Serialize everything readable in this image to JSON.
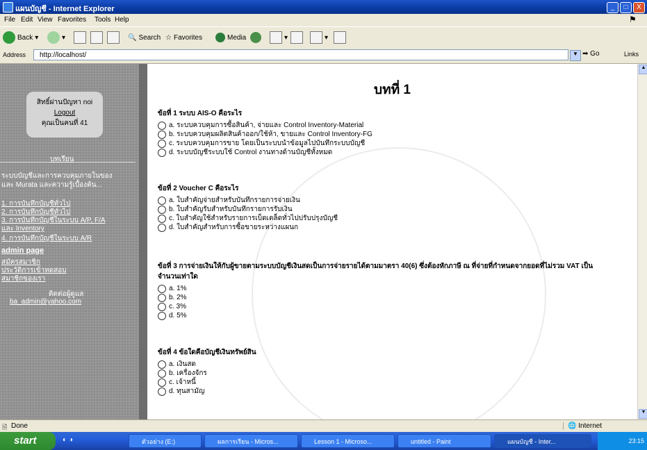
{
  "window": {
    "title": "แผนบัญชี - Internet Explorer",
    "controls": [
      "_",
      "□",
      "X"
    ]
  },
  "menu": [
    "File",
    "Edit",
    "View",
    "Favorites",
    "Tools",
    "Help"
  ],
  "toolbar": {
    "back": "Back",
    "search": "Search",
    "favorites": "Favorites",
    "media": "Media"
  },
  "address": {
    "label": "Address",
    "value": "http://localhost/",
    "go": "Go",
    "links": "Links"
  },
  "sidebar": {
    "user": {
      "line1": "สิทธิ์ผ่านปัญหา noi",
      "logout": "Logout",
      "line3": "คุณเป็นคนที่ 41"
    },
    "heading": "บทเรียน",
    "intro1": "ระบบบัญชีและการควบคุมภายในของ",
    "intro2": "และ Murata และความรู้เบื้องต้น...",
    "links": [
      "1. การบันทึกบัญชีทั่วไป",
      "2. การบันทึกบัญชีทั่วไป",
      "3. การบันทึกบัญชีในระบบ A/P, F/A",
      "และ Inventory",
      "4. การบันทึกบัญชีในระบบ A/R"
    ],
    "admin": "admin page",
    "admin_links": [
      "สมัครสมาชิก",
      "ประวัติการเข้าทดสอบ",
      "สมาชิกของเรา"
    ],
    "contact_label": "ติดต่อผู้ดูแล",
    "email": "ba_admin@yahoo.com"
  },
  "content": {
    "title": "บทที่ 1",
    "questions": [
      {
        "q": "ข้อที่ 1  ระบบ AIS-O คือระไร",
        "options": [
          "a. ระบบควบคุมการซื้อสินค้า, จ่ายและ Control Inventory-Material",
          "b. ระบบควบคุมผลิตสินค้าออก/ใช้ห้า, ขายและ Control Inventory-FG",
          "c. ระบบควบคุมการขาย โดยเป็นระบบนำข้อมูลไปบันทึกระบบบัญชี",
          "d. ระบบบัญชีระบบใช้ Control งานทางด้านบัญชีทั้งหมด"
        ]
      },
      {
        "q": "ข้อที่ 2  Voucher C คือระไร",
        "options": [
          "a. ใบสำคัญจ่ายสำหรับบันทึกรายการจ่ายเงิน",
          "b. ใบสำคัญรับสำหรับบันทึกรายการรับเงิน",
          "c. ใบสำคัญใช้สำหรับรายการเบ็ดเตล็ดทั่วไปปรับปรุงบัญชี",
          "d. ใบสำคัญสำหรับการซื้อขายระหว่างแผนก"
        ]
      },
      {
        "q": "ข้อที่ 3  การจ่ายเงินให้กับผู้ขายตามระบบบัญชีเงินสดเป็นการจ่ายรายได้ตามมาตรา 40(6) ซึ่งต้องหักภาษี ณ ที่จ่ายที่กำหนดจากยอดที่ไม่รวม VAT เป็นจำนวนเท่าใด",
        "options": [
          "a. 1%",
          "b. 2%",
          "c. 3%",
          "d. 5%"
        ]
      },
      {
        "q": "ข้อที่ 4  ข้อใดคือบัญชีเงินทรัพย์สิน",
        "options": [
          "a. เงินสด",
          "b. เครื่องจักร",
          "c. เจ้าหนี้",
          "d. ทุนสามัญ"
        ]
      }
    ]
  },
  "status": {
    "done": "Done",
    "zone": "Internet"
  },
  "taskbar": {
    "start": "start",
    "tasks": [
      "ตัวอย่าง (E:)",
      "ผลการเรียน - Micros...",
      "Lesson 1 - Microso...",
      "untitled - Paint",
      "แผนบัญชี - Inter..."
    ],
    "clock": "23:15"
  }
}
